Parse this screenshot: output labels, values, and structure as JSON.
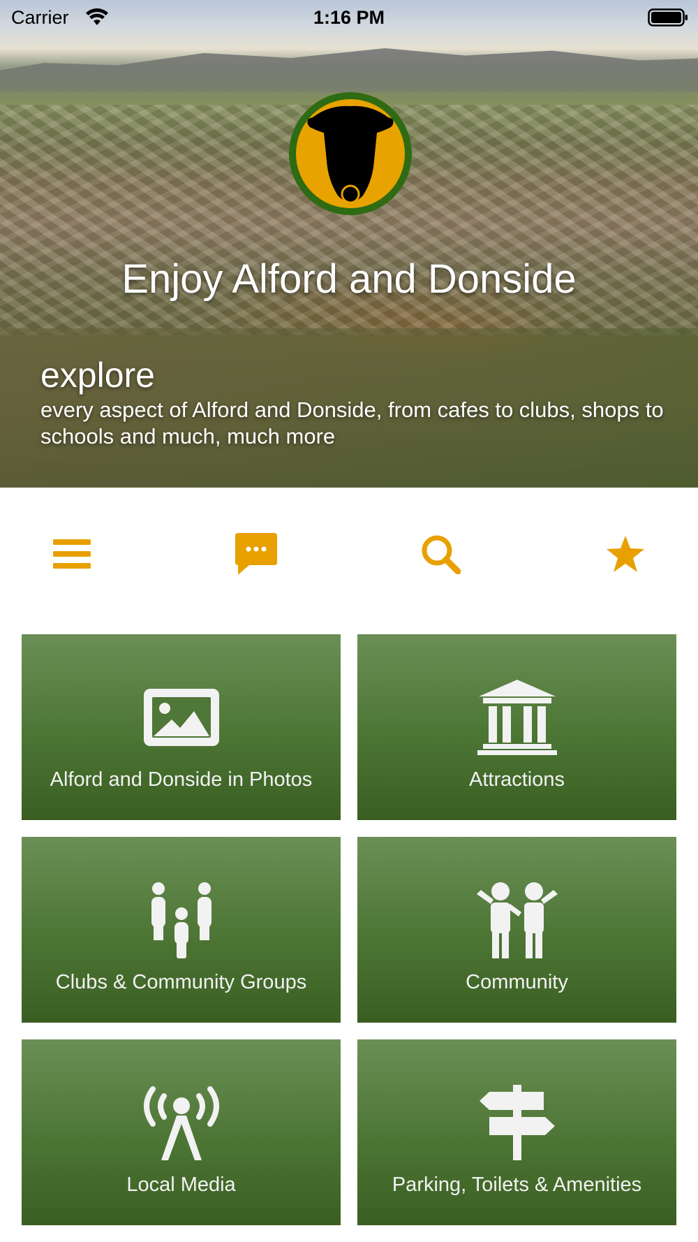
{
  "status_bar": {
    "carrier": "Carrier",
    "time": "1:16 PM",
    "wifi_icon": "wifi-icon",
    "battery_icon": "battery-icon"
  },
  "hero": {
    "title": "Enjoy Alford and Donside",
    "explore": "explore",
    "description": "every aspect of Alford and Donside, from cafes to clubs, shops to schools and much, much more",
    "logo_icon": "bull-head-logo"
  },
  "toolbar": {
    "accent_color": "#e8a000",
    "items": [
      {
        "icon": "menu-icon"
      },
      {
        "icon": "chat-icon"
      },
      {
        "icon": "search-icon"
      },
      {
        "icon": "star-icon"
      }
    ]
  },
  "tiles": [
    {
      "label": "Alford and Donside in Photos",
      "icon": "image-icon"
    },
    {
      "label": "Attractions",
      "icon": "museum-icon"
    },
    {
      "label": "Clubs & Community Groups",
      "icon": "family-icon"
    },
    {
      "label": "Community",
      "icon": "children-icon"
    },
    {
      "label": "Local Media",
      "icon": "broadcast-icon"
    },
    {
      "label": "Parking, Toilets & Amenities",
      "icon": "signpost-icon"
    }
  ],
  "colors": {
    "tile_top": "#6b8f56",
    "tile_bottom": "#3a5e22",
    "tile_text": "#f2f2f2",
    "logo_ring": "#2e6b12",
    "logo_fill": "#e8a300"
  }
}
